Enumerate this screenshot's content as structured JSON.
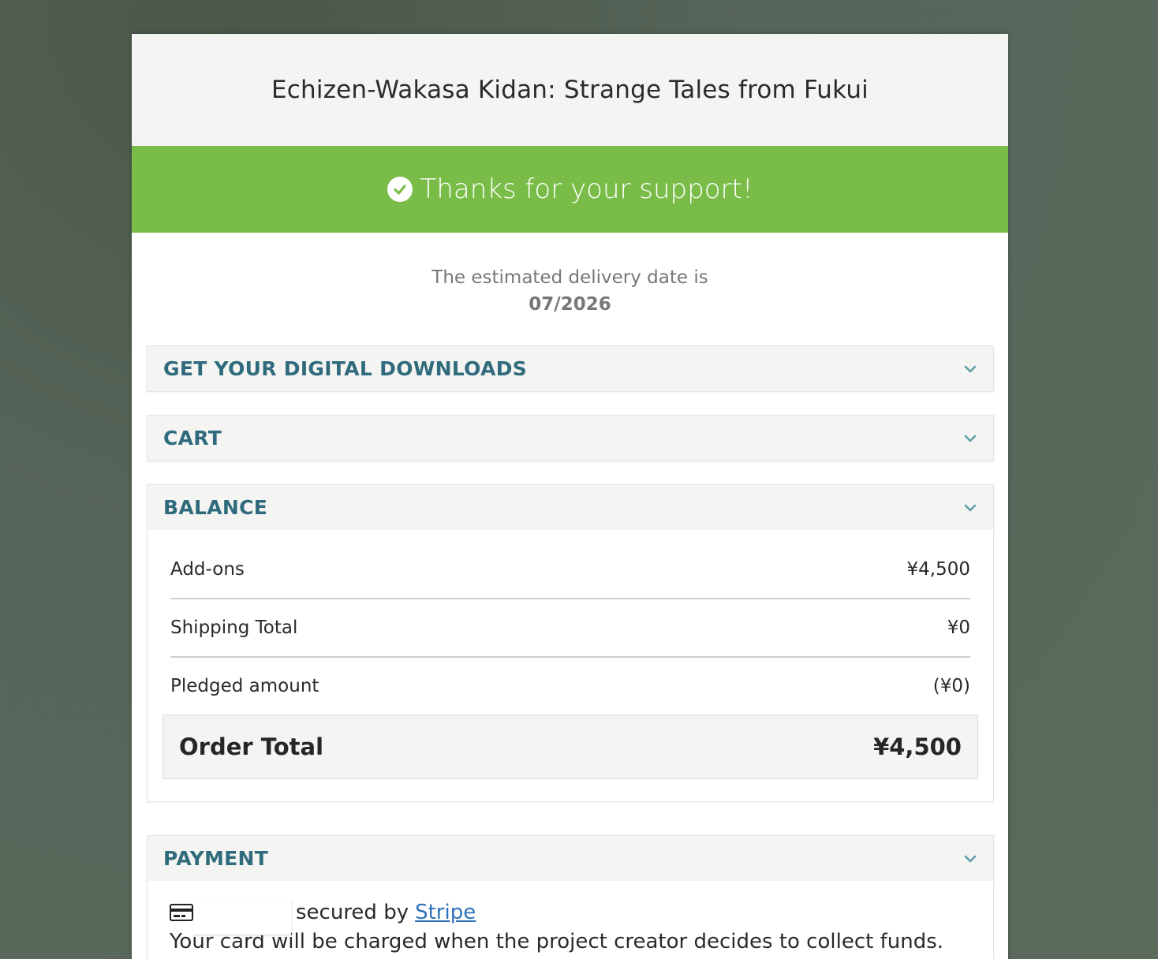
{
  "project": {
    "title": "Echizen-Wakasa Kidan: Strange Tales from Fukui"
  },
  "banner": {
    "message": "Thanks for your support!",
    "icon": "check-circle-icon",
    "color": "#79bd48"
  },
  "delivery": {
    "text": "The estimated delivery date is",
    "date": "07/2026"
  },
  "sections": {
    "downloads": {
      "label": "GET YOUR DIGITAL DOWNLOADS"
    },
    "cart": {
      "label": "CART"
    },
    "balance": {
      "label": "BALANCE",
      "rows": [
        {
          "label": "Add-ons",
          "value": "¥4,500"
        },
        {
          "label": "Shipping Total",
          "value": "¥0"
        },
        {
          "label": "Pledged amount",
          "value": "(¥0)"
        }
      ],
      "total": {
        "label": "Order Total",
        "value": "¥4,500"
      }
    },
    "payment": {
      "label": "PAYMENT",
      "secured_text": "secured by",
      "stripe_link": "Stripe",
      "charge_note": "Your card will be charged when the project creator decides to collect funds."
    }
  },
  "colors": {
    "section_title": "#2f6b7c",
    "link": "#2f72b8"
  }
}
